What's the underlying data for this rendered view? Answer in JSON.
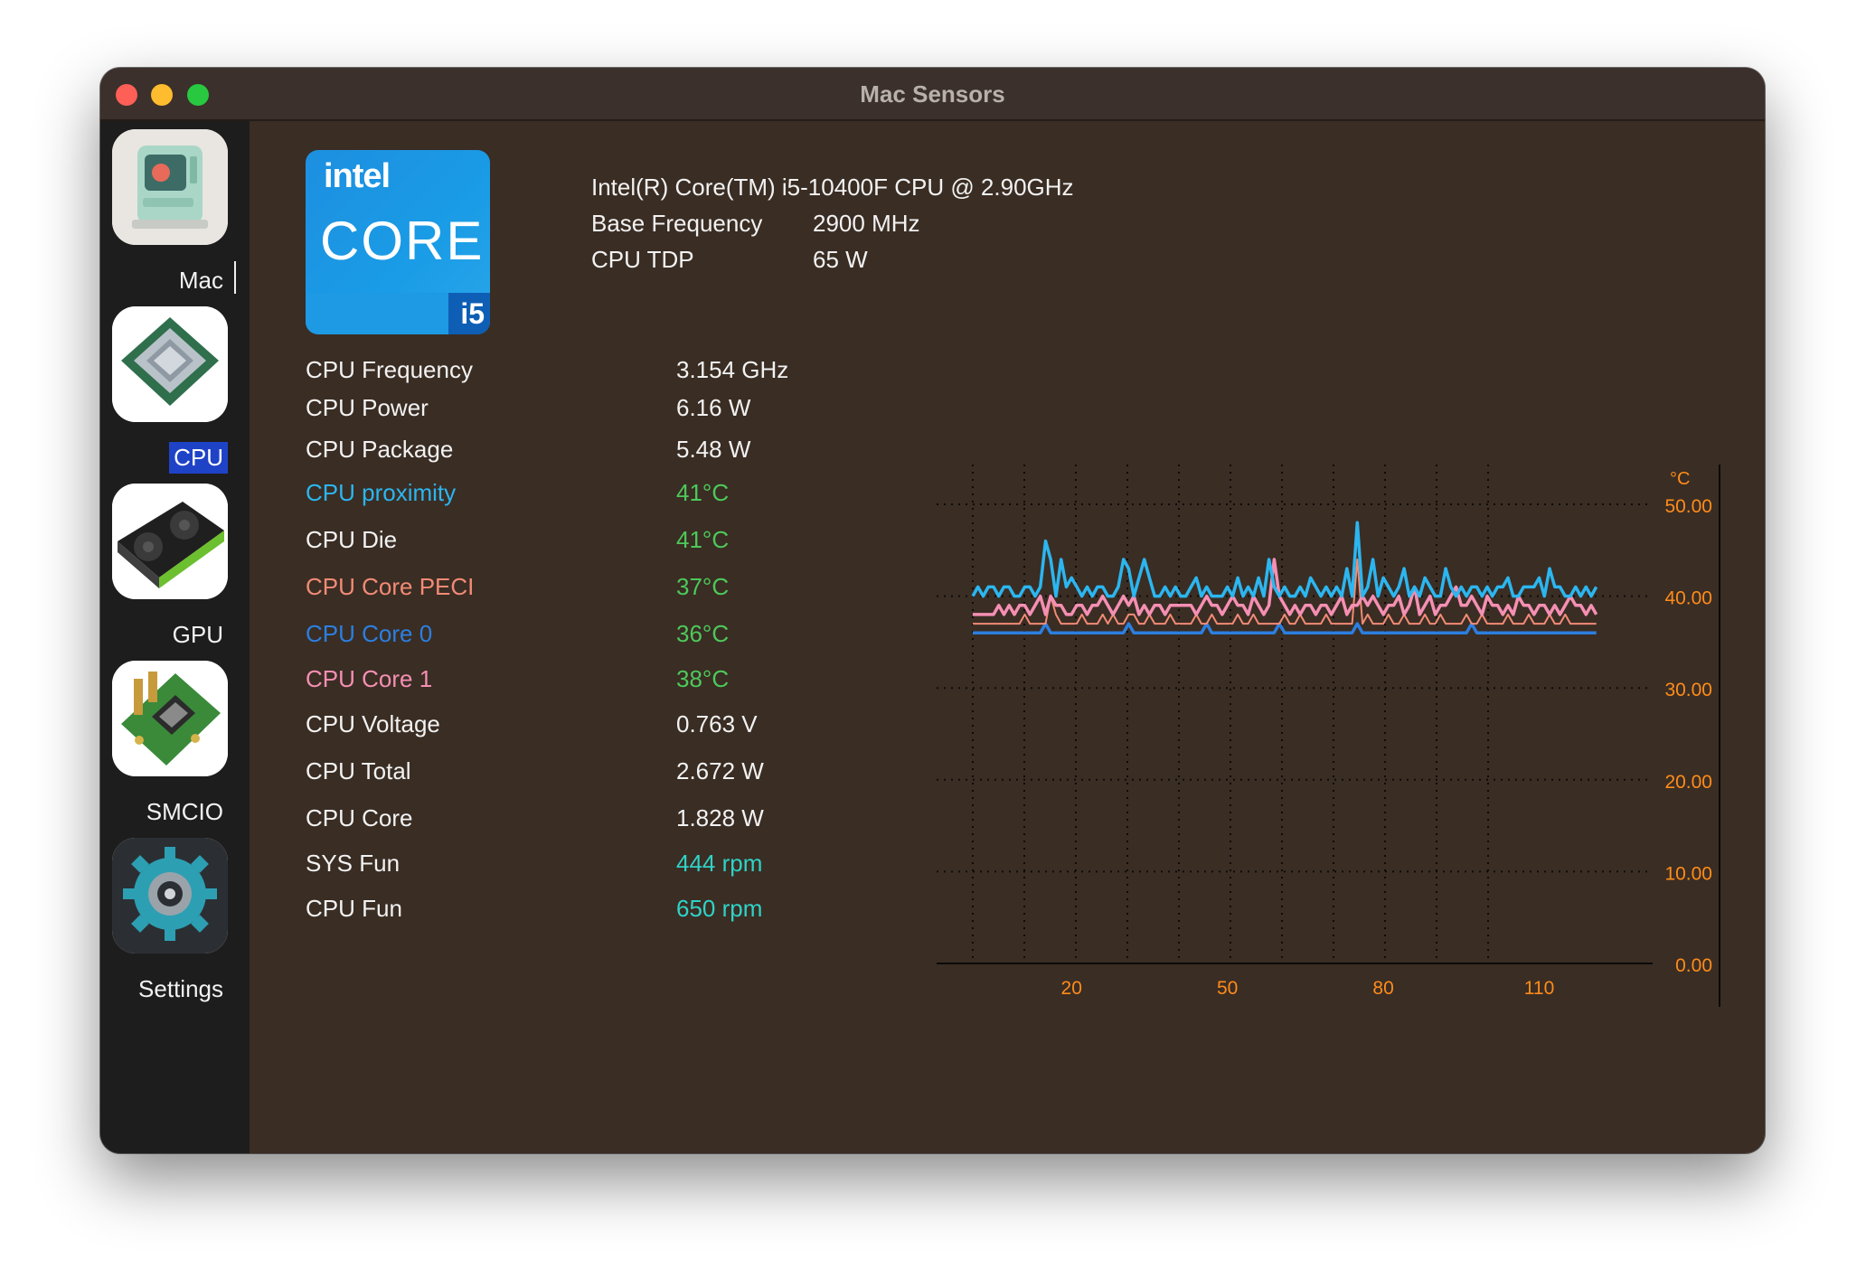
{
  "window": {
    "title": "Mac Sensors"
  },
  "sidebar": {
    "items": [
      {
        "label": "Mac",
        "icon": "retro-mac-icon",
        "selected": false
      },
      {
        "label": "CPU",
        "icon": "cpu-chip-icon",
        "selected": true
      },
      {
        "label": "GPU",
        "icon": "graphics-card-icon",
        "selected": false
      },
      {
        "label": "SMCIO",
        "icon": "motherboard-icon",
        "selected": false
      },
      {
        "label": "Settings",
        "icon": "gear-icon",
        "selected": false
      }
    ]
  },
  "cpu": {
    "logo": {
      "brand": "intel",
      "line": "CORE",
      "tier": "i5"
    },
    "name": "Intel(R) Core(TM) i5-10400F CPU @ 2.90GHz",
    "info": [
      {
        "label": "Base Frequency",
        "value": "2900 MHz"
      },
      {
        "label": "CPU TDP",
        "value": "65 W"
      }
    ]
  },
  "sensors": [
    {
      "label": "CPU Frequency",
      "value": "3.154 GHz",
      "label_color": "#f2f2f2",
      "value_color": "#f2f2f2"
    },
    {
      "label": "CPU Power",
      "value": "6.16 W",
      "label_color": "#f2f2f2",
      "value_color": "#f2f2f2"
    },
    {
      "label": "CPU Package",
      "value": "5.48 W",
      "label_color": "#f2f2f2",
      "value_color": "#f2f2f2"
    },
    {
      "label": "CPU proximity",
      "value": "41°C",
      "label_color": "#2bb6f0",
      "value_color": "#4cc95a"
    },
    {
      "label": "CPU Die",
      "value": "41°C",
      "label_color": "#f2f2f2",
      "value_color": "#4cc95a"
    },
    {
      "label": "CPU Core PECI",
      "value": "37°C",
      "label_color": "#f28b75",
      "value_color": "#4cc95a"
    },
    {
      "label": "CPU Core 0",
      "value": "36°C",
      "label_color": "#2b7fe0",
      "value_color": "#4cc95a"
    },
    {
      "label": "CPU Core 1",
      "value": "38°C",
      "label_color": "#f58fb3",
      "value_color": "#4cc95a"
    },
    {
      "label": "CPU Voltage",
      "value": "0.763 V",
      "label_color": "#f2f2f2",
      "value_color": "#f2f2f2"
    },
    {
      "label": "CPU Total",
      "value": "2.672 W",
      "label_color": "#f2f2f2",
      "value_color": "#f2f2f2"
    },
    {
      "label": "CPU Core",
      "value": "1.828 W",
      "label_color": "#f2f2f2",
      "value_color": "#f2f2f2"
    },
    {
      "label": "SYS Fun",
      "value": "444 rpm",
      "label_color": "#f2f2f2",
      "value_color": "#2fd3c7"
    },
    {
      "label": "CPU Fun",
      "value": "650 rpm",
      "label_color": "#f2f2f2",
      "value_color": "#2fd3c7"
    }
  ],
  "chart_data": {
    "type": "line",
    "unit_label": "°C",
    "xlim": [
      0,
      120
    ],
    "ylim": [
      0,
      50
    ],
    "x_ticks": [
      20,
      50,
      80,
      110
    ],
    "y_ticks": [
      "0.00",
      "10.00",
      "20.00",
      "30.00",
      "40.00",
      "50.00"
    ],
    "grid": true,
    "axis_color": "#ff8c1a",
    "series": [
      {
        "color": "#2bb6f0",
        "x_start": 1,
        "values": [
          40,
          41,
          40,
          41,
          41,
          40,
          41,
          41,
          40,
          40,
          41,
          41,
          40,
          41,
          46,
          44,
          40,
          44,
          41,
          42,
          41,
          40,
          41,
          40,
          41,
          41,
          40,
          40,
          41,
          44,
          43,
          40,
          42,
          44,
          42,
          40,
          40,
          41,
          40,
          41,
          40,
          40,
          41,
          42,
          40,
          41,
          40,
          40,
          40,
          41,
          40,
          42,
          40,
          41,
          40,
          42,
          40,
          44,
          41,
          40,
          41,
          40,
          40,
          41,
          40,
          42,
          41,
          40,
          41,
          40,
          41,
          40,
          43,
          40,
          48,
          40,
          41,
          44,
          40,
          42,
          41,
          40,
          41,
          43,
          40,
          41,
          40,
          42,
          41,
          40,
          40,
          43,
          41,
          40,
          41,
          40,
          41,
          41,
          40,
          41,
          40,
          41,
          41,
          42,
          40,
          40,
          41,
          41,
          41,
          42,
          40,
          43,
          41,
          41,
          40,
          40,
          41,
          40,
          41,
          40,
          41
        ]
      },
      {
        "color": "#f58fb3",
        "x_start": 1,
        "values": [
          38,
          38,
          38,
          38,
          38,
          39,
          38,
          39,
          38,
          39,
          39,
          38,
          39,
          40,
          38,
          40,
          39,
          39,
          38,
          38,
          39,
          39,
          38,
          39,
          39,
          40,
          39,
          38,
          39,
          40,
          39,
          40,
          38,
          39,
          38,
          39,
          39,
          38,
          39,
          39,
          39,
          39,
          39,
          38,
          39,
          40,
          39,
          39,
          38,
          39,
          40,
          39,
          39,
          38,
          40,
          39,
          38,
          39,
          44,
          40,
          39,
          38,
          39,
          38,
          39,
          39,
          38,
          39,
          39,
          38,
          39,
          40,
          38,
          39,
          39,
          40,
          39,
          40,
          39,
          38,
          39,
          39,
          40,
          38,
          39,
          41,
          38,
          39,
          40,
          38,
          39,
          39,
          40,
          41,
          39,
          39,
          40,
          39,
          38,
          40,
          39,
          39,
          38,
          39,
          38,
          40,
          39,
          39,
          38,
          39,
          39,
          38,
          39,
          38,
          39,
          40,
          39,
          39,
          38,
          39,
          38
        ]
      },
      {
        "color": "#f28b75",
        "x_start": 1,
        "values": [
          37,
          37,
          37,
          37,
          37,
          37,
          37,
          37,
          37,
          37,
          38,
          37,
          37,
          37,
          37,
          40,
          38,
          37,
          37,
          37,
          37,
          38,
          37,
          37,
          37,
          38,
          37,
          38,
          37,
          37,
          38,
          38,
          37,
          37,
          38,
          37,
          37,
          37,
          38,
          37,
          37,
          37,
          37,
          38,
          37,
          37,
          38,
          37,
          37,
          37,
          37,
          38,
          37,
          37,
          38,
          37,
          37,
          37,
          37,
          37,
          38,
          37,
          37,
          38,
          37,
          37,
          37,
          37,
          38,
          37,
          37,
          37,
          37,
          37,
          44,
          37,
          38,
          37,
          37,
          37,
          38,
          37,
          37,
          38,
          37,
          37,
          37,
          38,
          37,
          37,
          38,
          37,
          37,
          37,
          37,
          38,
          37,
          37,
          38,
          37,
          37,
          37,
          37,
          38,
          37,
          37,
          37,
          38,
          37,
          37,
          37,
          38,
          37,
          37,
          38,
          37,
          37,
          37,
          37,
          37,
          37
        ]
      },
      {
        "color": "#2b7fe0",
        "x_start": 1,
        "values": [
          36,
          36,
          36,
          36,
          36,
          36,
          36,
          36,
          36,
          36,
          36,
          36,
          36,
          36,
          37,
          36,
          36,
          36,
          36,
          36,
          36,
          36,
          36,
          36,
          36,
          36,
          36,
          36,
          36,
          36,
          37,
          36,
          36,
          36,
          36,
          36,
          36,
          36,
          36,
          36,
          36,
          36,
          36,
          36,
          36,
          37,
          36,
          36,
          36,
          36,
          36,
          36,
          36,
          36,
          36,
          36,
          36,
          36,
          36,
          37,
          36,
          36,
          36,
          36,
          36,
          36,
          36,
          36,
          36,
          36,
          36,
          36,
          36,
          36,
          37,
          36,
          36,
          36,
          36,
          36,
          36,
          36,
          36,
          36,
          36,
          36,
          36,
          36,
          36,
          36,
          36,
          36,
          36,
          36,
          36,
          36,
          37,
          36,
          36,
          36,
          36,
          36,
          36,
          36,
          36,
          36,
          36,
          36,
          36,
          36,
          36,
          36,
          36,
          36,
          36,
          36,
          36,
          36,
          36,
          36,
          36
        ]
      }
    ]
  }
}
